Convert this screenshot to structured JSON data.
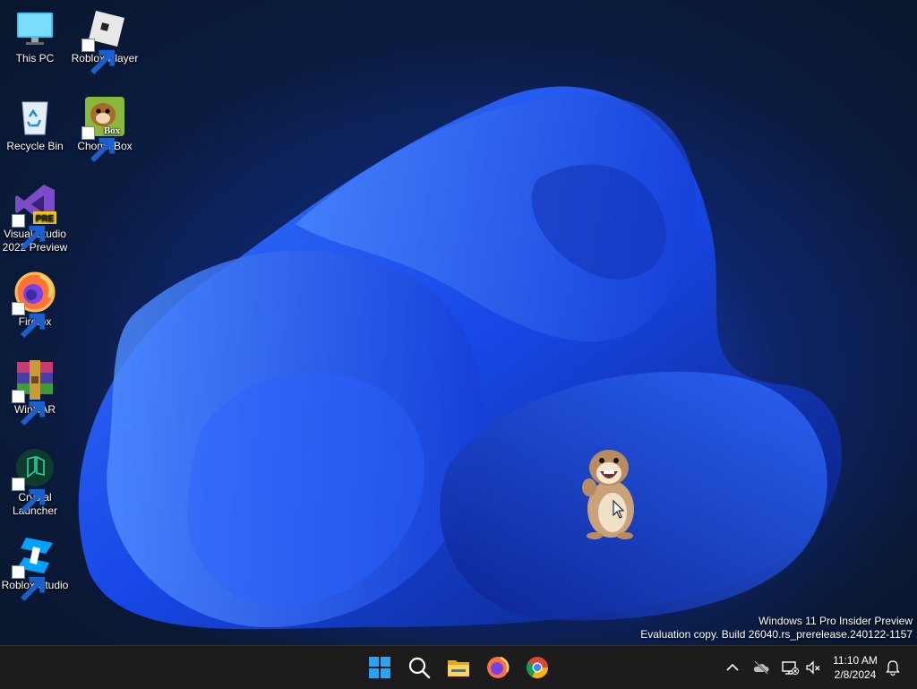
{
  "desktop_icons": [
    {
      "label": "This PC",
      "icon": "monitor-icon",
      "shortcut": false
    },
    {
      "label": "Roblox Player",
      "icon": "roblox-player-icon",
      "shortcut": true
    },
    {
      "label": "Recycle Bin",
      "icon": "recycle-bin-icon",
      "shortcut": false
    },
    {
      "label": "ChomikBox",
      "icon": "chomikbox-icon",
      "shortcut": true,
      "badge": "Box"
    },
    {
      "label_line1": "Visual Studio",
      "label_line2": "2022 Preview",
      "icon": "visual-studio-icon",
      "shortcut": true,
      "badge": "PRE"
    },
    {
      "label": "Firefox",
      "icon": "firefox-icon",
      "shortcut": true
    },
    {
      "label": "WinRAR",
      "icon": "winrar-icon",
      "shortcut": true
    },
    {
      "label_line1": "Crystal",
      "label_line2": "Launcher",
      "icon": "crystal-launcher-icon",
      "shortcut": true
    },
    {
      "label": "Roblox Studio",
      "icon": "roblox-studio-icon",
      "shortcut": true
    }
  ],
  "watermark": {
    "line1": "Windows 11 Pro Insider Preview",
    "line2": "Evaluation copy. Build 26040.rs_prerelease.240122-1157"
  },
  "taskbar": {
    "pinned": [
      "start-icon",
      "search-icon",
      "file-explorer-icon",
      "firefox-icon",
      "chrome-icon"
    ],
    "tray": [
      "chevron-up-icon",
      "onedrive-offline-icon",
      "network-disconnected-icon",
      "volume-muted-icon"
    ],
    "time": "11:10 AM",
    "date": "2/8/2024",
    "notification": "bell-icon"
  },
  "colors": {
    "taskbar": "#1c1c1c",
    "accent_blue": "#1f5bff",
    "windows_logo": "#29a3f5"
  }
}
